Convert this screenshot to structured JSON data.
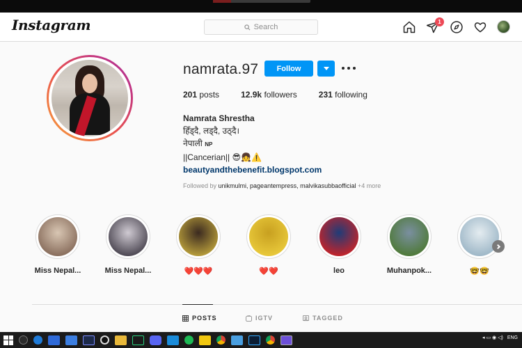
{
  "app": {
    "logo": "Instagram"
  },
  "search": {
    "placeholder": "Search"
  },
  "nav": {
    "activity_badge": "1"
  },
  "profile": {
    "username": "namrata.97",
    "follow_label": "Follow",
    "posts_count": "201",
    "posts_label": "posts",
    "followers_count": "12.9k",
    "followers_label": "followers",
    "following_count": "231",
    "following_label": "following",
    "full_name": "Namrata Shrestha",
    "bio_line1": "हिँड्दै, लड्दै, उठ्दै।",
    "bio_line2": "नेपाली",
    "bio_line2_flag": "NP",
    "bio_line3": "||Cancerian|| 😎👧⚠️",
    "website": "beautyandthebenefit.blogspot.com",
    "followed_by_prefix": "Followed by ",
    "followed_by_users": "unikmulmi, pageantempress, malvikasubbaofficial",
    "followed_by_more": "+4 more"
  },
  "highlights": [
    {
      "label": "Miss Nepal...",
      "color_a": "#8a6f5e",
      "color_b": "#d8c6b3"
    },
    {
      "label": "Miss Nepal...",
      "color_a": "#4f4a55",
      "color_b": "#cfcad2"
    },
    {
      "label": "❤️❤️❤️",
      "color_a": "#b49a3a",
      "color_b": "#3b2a20"
    },
    {
      "label": "❤️❤️",
      "color_a": "#e8c83a",
      "color_b": "#c8a020"
    },
    {
      "label": "leo",
      "color_a": "#c0242b",
      "color_b": "#1f3c78"
    },
    {
      "label": "Muhanpok...",
      "color_a": "#4f7a3a",
      "color_b": "#7a8fa0"
    },
    {
      "label": "🤓🤓",
      "color_a": "#9fb8c8",
      "color_b": "#e4ecf0"
    }
  ],
  "tabs": [
    {
      "label": "POSTS",
      "icon": "grid-icon"
    },
    {
      "label": "IGTV",
      "icon": "igtv-icon"
    },
    {
      "label": "TAGGED",
      "icon": "tagged-icon"
    }
  ],
  "tray": {
    "lang": "ENG"
  }
}
